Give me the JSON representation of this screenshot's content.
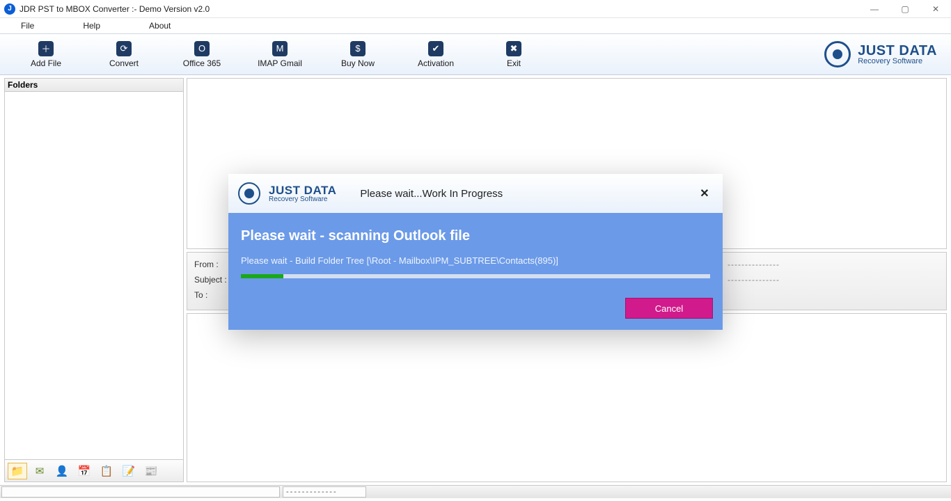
{
  "window": {
    "title": "JDR PST to MBOX Converter :- Demo Version v2.0"
  },
  "menu": {
    "file": "File",
    "help": "Help",
    "about": "About"
  },
  "toolbar": {
    "add_file": "Add File",
    "convert": "Convert",
    "office365": "Office 365",
    "imap_gmail": "IMAP Gmail",
    "buy_now": "Buy Now",
    "activation": "Activation",
    "exit": "Exit"
  },
  "brand": {
    "name": "JUST DATA",
    "tag": "Recovery Software"
  },
  "folders": {
    "header": "Folders"
  },
  "details": {
    "from": "From :",
    "subject": "Subject :",
    "to": "To :",
    "dashes": "---------------"
  },
  "status": {
    "dashes": "-------------"
  },
  "modal": {
    "wait": "Please wait...Work In Progress",
    "heading": "Please wait - scanning Outlook file",
    "message": "Please wait - Build Folder Tree [\\Root - Mailbox\\IPM_SUBTREE\\Contacts(895)]",
    "cancel": "Cancel",
    "progress_pct": 9
  }
}
